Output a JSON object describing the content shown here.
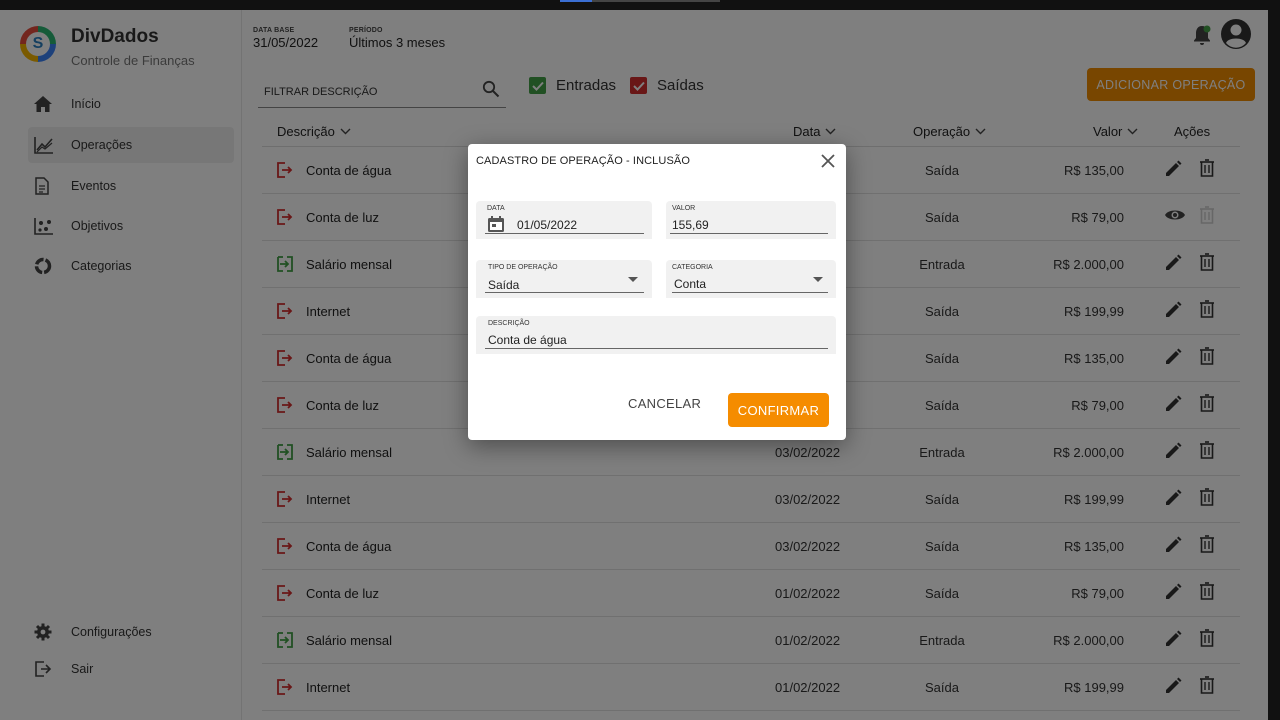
{
  "app": {
    "name": "DivDados",
    "subtitle": "Controle de Finanças",
    "logo_letter": "S"
  },
  "colors": {
    "accent": "#f08c00",
    "income_green": "#43a047",
    "expense_red": "#d32f2f"
  },
  "sidebar": {
    "items": [
      {
        "label": "Início",
        "icon": "home-icon"
      },
      {
        "label": "Operações",
        "icon": "chart-line-icon",
        "active": true
      },
      {
        "label": "Eventos",
        "icon": "document-icon"
      },
      {
        "label": "Objetivos",
        "icon": "scatter-icon"
      },
      {
        "label": "Categorias",
        "icon": "donut-icon"
      }
    ],
    "bottom": [
      {
        "label": "Configurações",
        "icon": "gear-icon"
      },
      {
        "label": "Sair",
        "icon": "logout-icon"
      }
    ]
  },
  "header": {
    "date_base_label": "DATA BASE",
    "date_base_value": "31/05/2022",
    "period_label": "PERÍODO",
    "period_value": "Últimos 3 meses"
  },
  "filters": {
    "search_label": "FILTRAR DESCRIÇÃO",
    "entradas_label": "Entradas",
    "saidas_label": "Saídas",
    "entradas_checked": true,
    "saidas_checked": true
  },
  "add_button_label": "ADICIONAR OPERAÇÃO",
  "table": {
    "headers": {
      "descricao": "Descrição",
      "data": "Data",
      "operacao": "Operação",
      "valor": "Valor",
      "acoes": "Ações"
    },
    "rows": [
      {
        "descricao": "Conta de água",
        "data": "",
        "operacao": "Saída",
        "valor": "R$ 135,00",
        "type": "out",
        "action": "edit"
      },
      {
        "descricao": "Conta de luz",
        "data": "",
        "operacao": "Saída",
        "valor": "R$ 79,00",
        "type": "out",
        "action": "view"
      },
      {
        "descricao": "Salário mensal",
        "data": "",
        "operacao": "Entrada",
        "valor": "R$ 2.000,00",
        "type": "in",
        "action": "edit"
      },
      {
        "descricao": "Internet",
        "data": "",
        "operacao": "Saída",
        "valor": "R$ 199,99",
        "type": "out",
        "action": "edit"
      },
      {
        "descricao": "Conta de água",
        "data": "",
        "operacao": "Saída",
        "valor": "R$ 135,00",
        "type": "out",
        "action": "edit"
      },
      {
        "descricao": "Conta de luz",
        "data": "",
        "operacao": "Saída",
        "valor": "R$ 79,00",
        "type": "out",
        "action": "edit"
      },
      {
        "descricao": "Salário mensal",
        "data": "03/02/2022",
        "operacao": "Entrada",
        "valor": "R$ 2.000,00",
        "type": "in",
        "action": "edit"
      },
      {
        "descricao": "Internet",
        "data": "03/02/2022",
        "operacao": "Saída",
        "valor": "R$ 199,99",
        "type": "out",
        "action": "edit"
      },
      {
        "descricao": "Conta de água",
        "data": "03/02/2022",
        "operacao": "Saída",
        "valor": "R$ 135,00",
        "type": "out",
        "action": "edit"
      },
      {
        "descricao": "Conta de luz",
        "data": "01/02/2022",
        "operacao": "Saída",
        "valor": "R$ 79,00",
        "type": "out",
        "action": "edit"
      },
      {
        "descricao": "Salário mensal",
        "data": "01/02/2022",
        "operacao": "Entrada",
        "valor": "R$ 2.000,00",
        "type": "in",
        "action": "edit"
      },
      {
        "descricao": "Internet",
        "data": "01/02/2022",
        "operacao": "Saída",
        "valor": "R$ 199,99",
        "type": "out",
        "action": "edit"
      }
    ]
  },
  "modal": {
    "title": "CADASTRO DE OPERAÇÃO - INCLUSÃO",
    "data_label": "DATA",
    "data_value": "01/05/2022",
    "valor_label": "VALOR",
    "valor_value": "155,69",
    "tipo_label": "TIPO DE OPERAÇÃO",
    "tipo_value": "Saída",
    "categoria_label": "CATEGORIA",
    "categoria_value": "Conta",
    "descricao_label": "DESCRIÇÃO",
    "descricao_value": "Conta de água",
    "cancel_label": "CANCELAR",
    "confirm_label": "CONFIRMAR"
  }
}
